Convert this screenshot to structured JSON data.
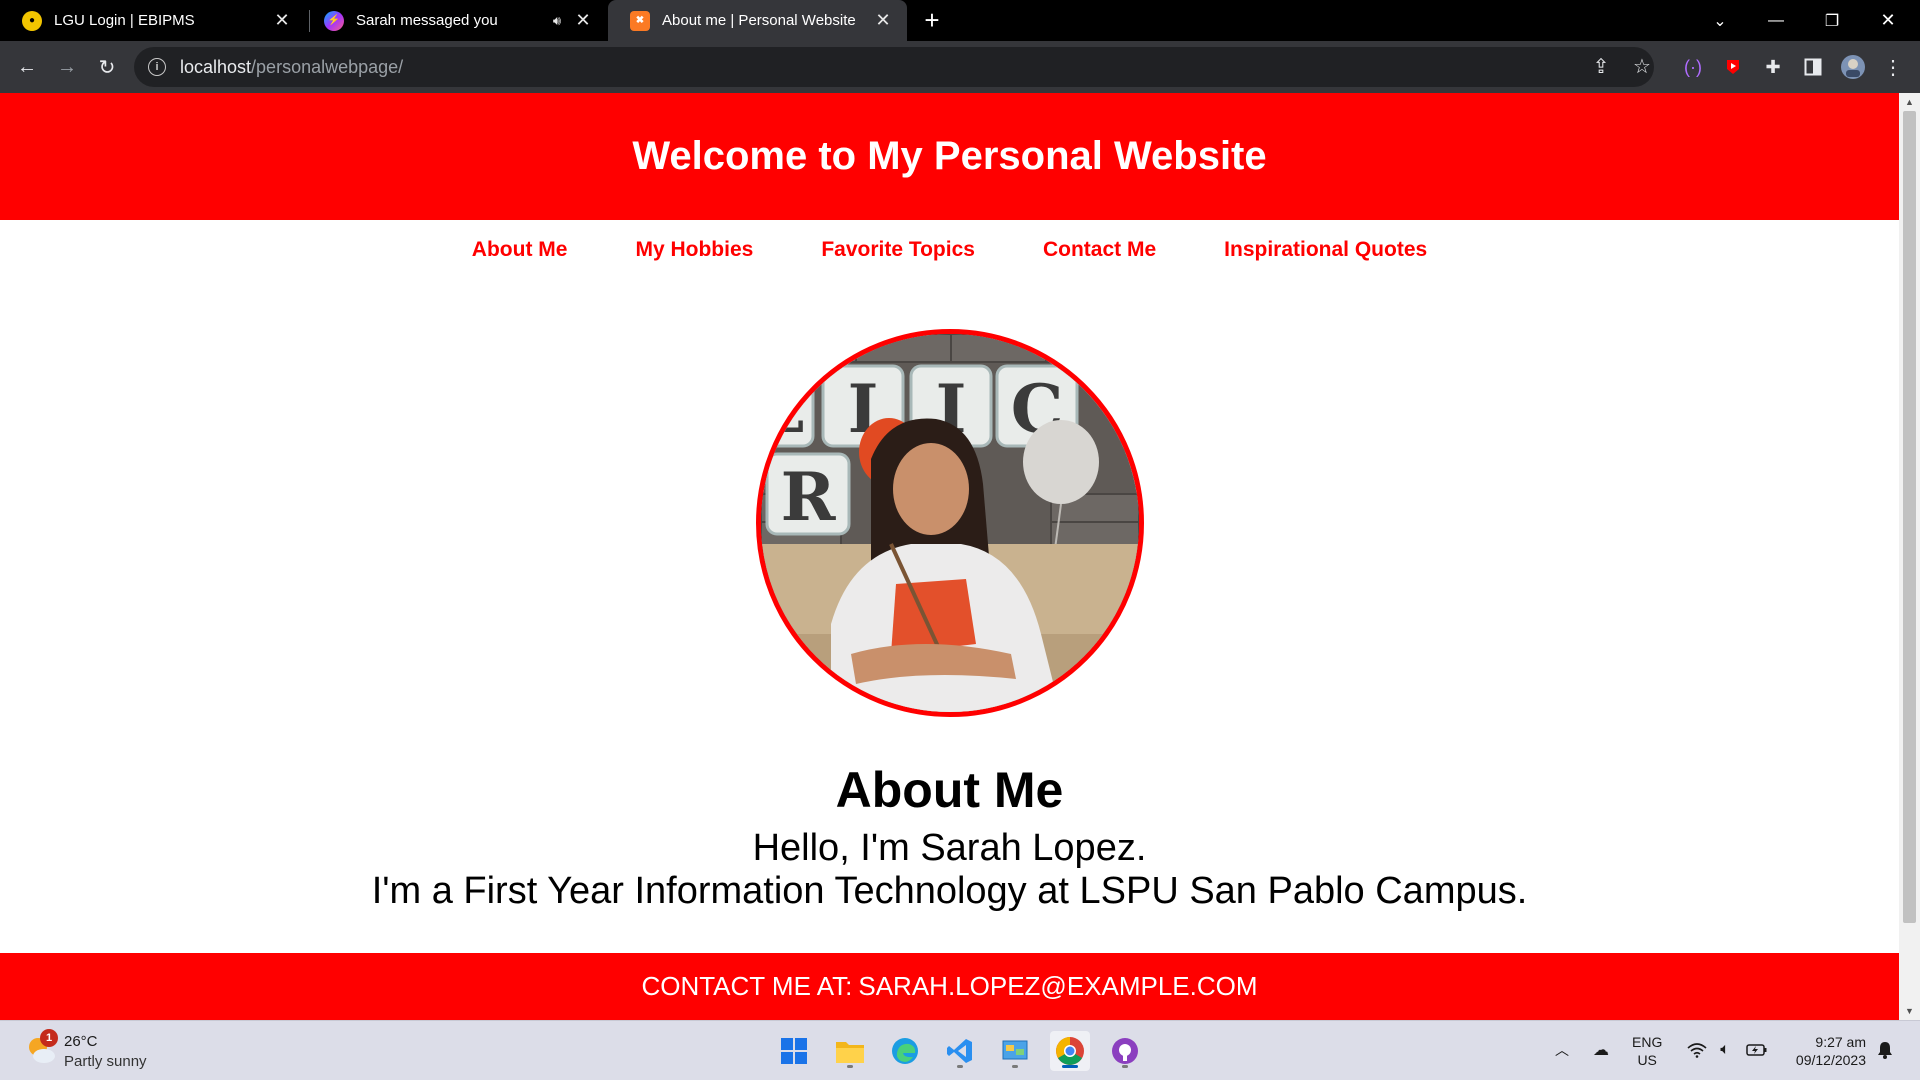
{
  "browser": {
    "tabs": [
      {
        "title": "LGU Login | EBIPMS",
        "active": false
      },
      {
        "title": "Sarah messaged you",
        "active": false,
        "audio": true
      },
      {
        "title": "About me | Personal Website",
        "active": true
      }
    ],
    "url": {
      "host": "localhost",
      "path": "/personalwebpage/"
    }
  },
  "page": {
    "header_title": "Welcome to My Personal Website",
    "nav": [
      "About Me",
      "My Hobbies",
      "Favorite Topics",
      "Contact Me",
      "Inspirational Quotes"
    ],
    "about_title": "About Me",
    "about_lines": [
      "Hello, I'm Sarah Lopez.",
      "I'm a First Year Information Technology at LSPU San Pablo Campus."
    ],
    "footer": {
      "prefix": "CONTACT ME AT:",
      "email": "SARAH.LOPEZ@EXAMPLE.COM"
    },
    "accent_color": "#ff0000"
  },
  "taskbar": {
    "weather": {
      "temp": "26°C",
      "desc": "Partly sunny",
      "badge": "1"
    },
    "language": {
      "lang": "ENG",
      "region": "US"
    },
    "clock": {
      "time": "9:27 am",
      "date": "09/12/2023"
    }
  }
}
